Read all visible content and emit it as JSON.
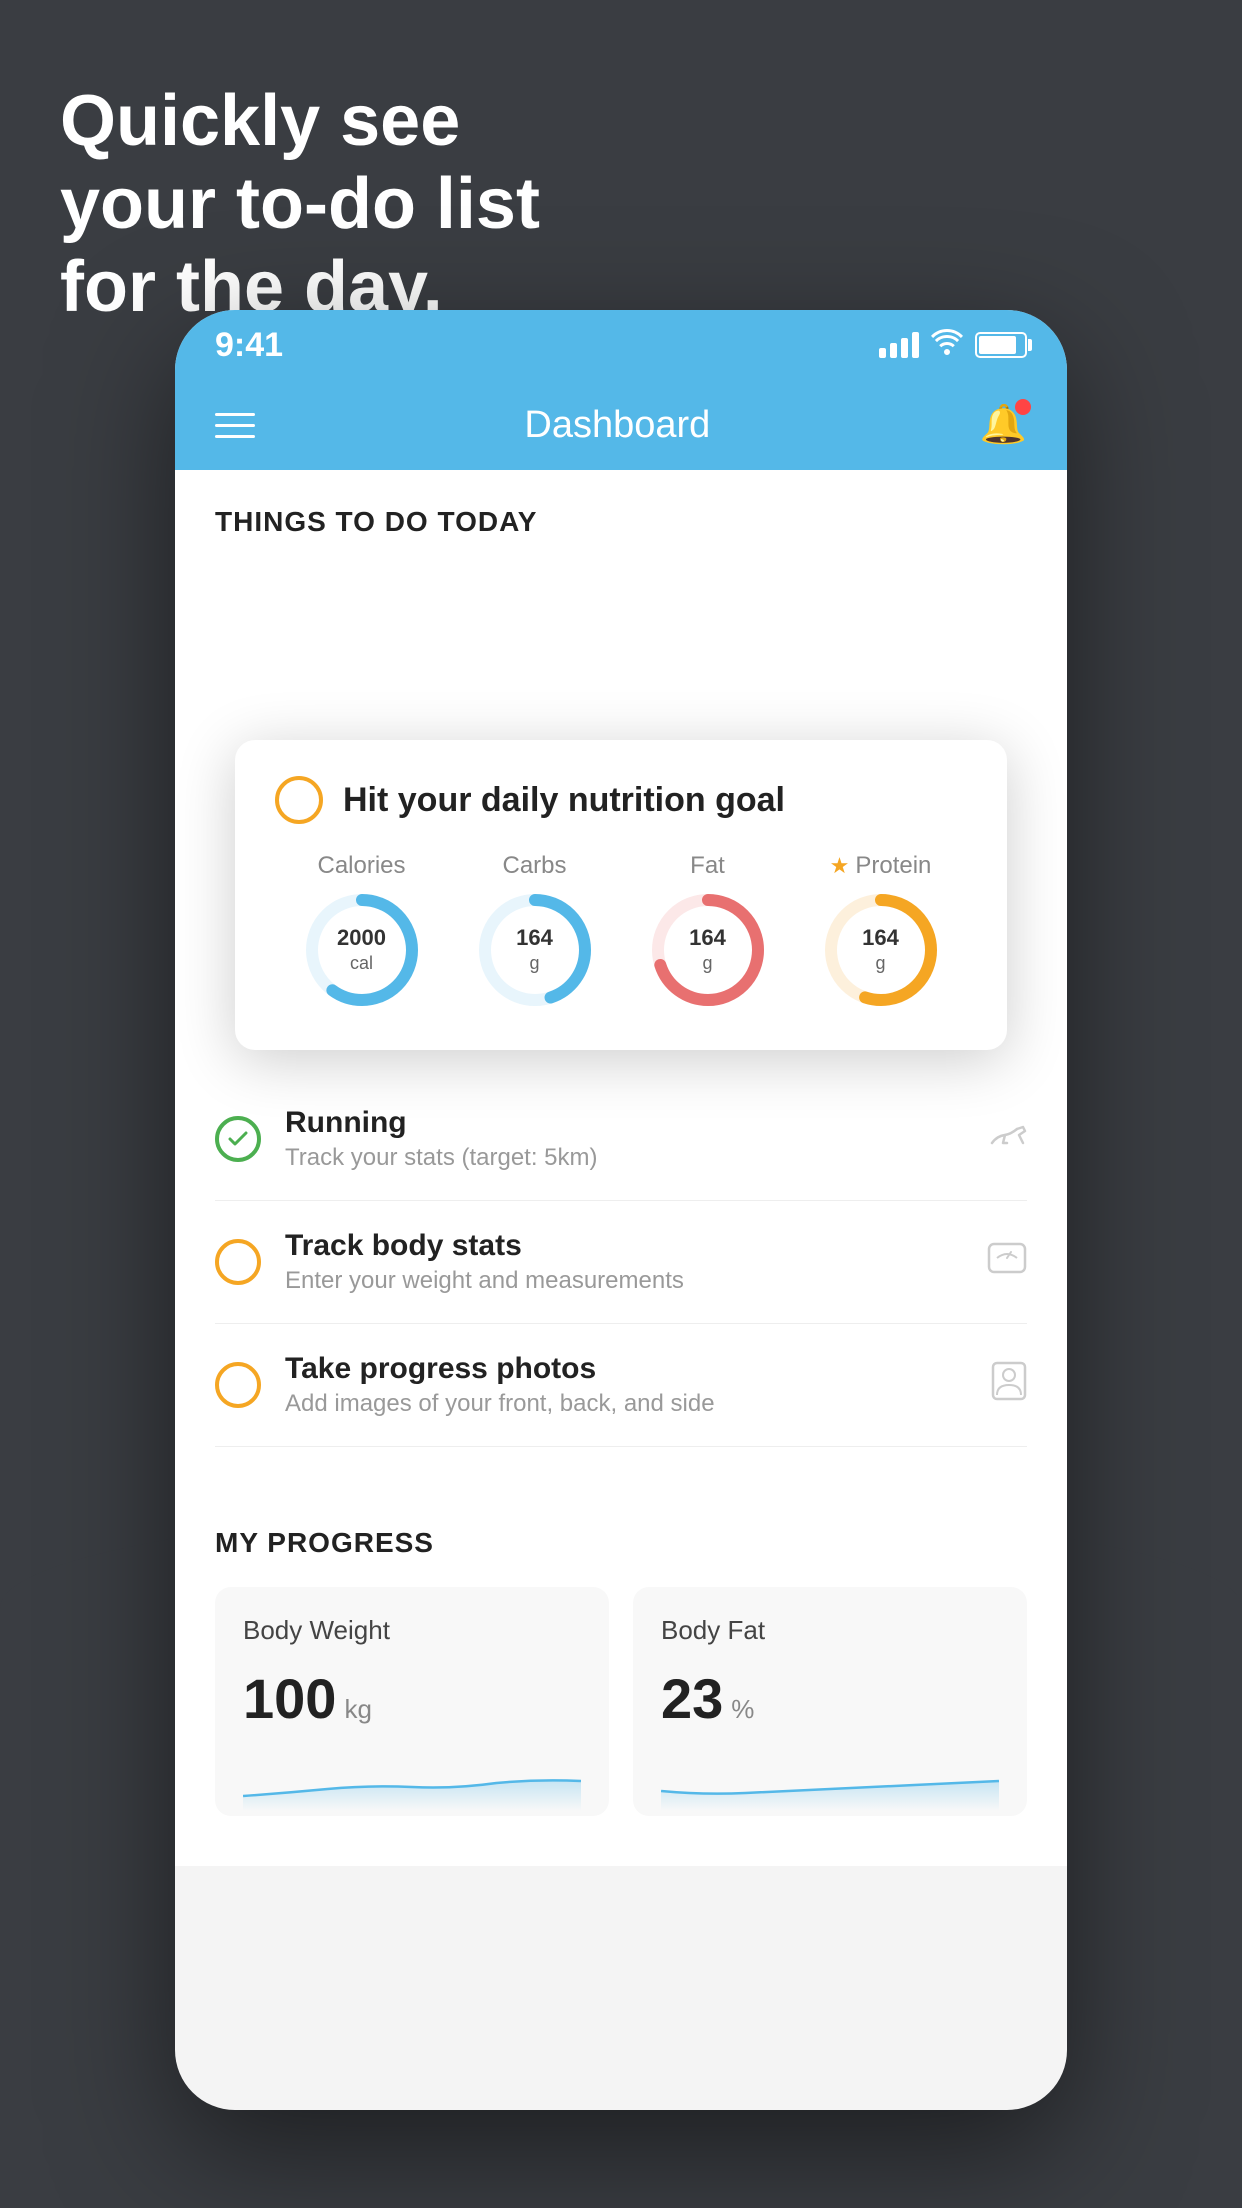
{
  "headline": {
    "line1": "Quickly see",
    "line2": "your to-do list",
    "line3": "for the day."
  },
  "status_bar": {
    "time": "9:41"
  },
  "nav": {
    "title": "Dashboard"
  },
  "things_to_do": {
    "section_title": "THINGS TO DO TODAY"
  },
  "nutrition_card": {
    "title": "Hit your daily nutrition goal",
    "metrics": [
      {
        "label": "Calories",
        "value": "2000",
        "unit": "cal",
        "color": "#54b8e8",
        "bg_color": "#e8f5fc",
        "percent": 60
      },
      {
        "label": "Carbs",
        "value": "164",
        "unit": "g",
        "color": "#54b8e8",
        "bg_color": "#e8f5fc",
        "percent": 45
      },
      {
        "label": "Fat",
        "value": "164",
        "unit": "g",
        "color": "#e87070",
        "bg_color": "#fce8e8",
        "percent": 70
      },
      {
        "label": "Protein",
        "value": "164",
        "unit": "g",
        "color": "#f5a623",
        "bg_color": "#fdf0dc",
        "percent": 55,
        "starred": true
      }
    ]
  },
  "todo_items": [
    {
      "title": "Running",
      "subtitle": "Track your stats (target: 5km)",
      "circle": "green",
      "icon": "shoe"
    },
    {
      "title": "Track body stats",
      "subtitle": "Enter your weight and measurements",
      "circle": "yellow",
      "icon": "scale"
    },
    {
      "title": "Take progress photos",
      "subtitle": "Add images of your front, back, and side",
      "circle": "yellow",
      "icon": "person"
    }
  ],
  "progress": {
    "section_title": "MY PROGRESS",
    "cards": [
      {
        "title": "Body Weight",
        "value": "100",
        "unit": "kg"
      },
      {
        "title": "Body Fat",
        "value": "23",
        "unit": "%"
      }
    ]
  }
}
